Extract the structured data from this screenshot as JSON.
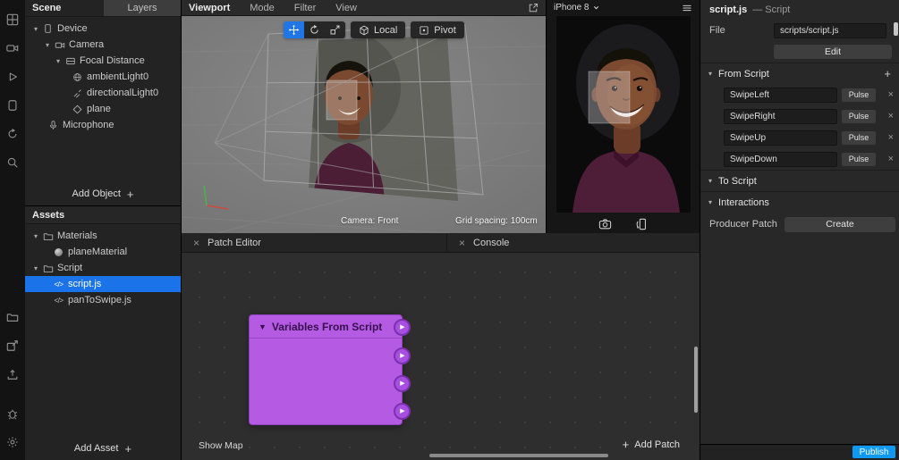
{
  "colors": {
    "accent_blue": "#1a73e8",
    "toolbar_active_blue": "#2176e5",
    "publish_blue": "#0f99f0",
    "node_purple": "#b55ae2",
    "viewport_gray": "#7c7c7c"
  },
  "rail": {
    "icons": [
      "apps-icon",
      "camera-icon",
      "play-icon",
      "device-icon",
      "sync-icon",
      "search-icon",
      "assets-icon",
      "export-icon",
      "upload-icon",
      "debug-icon",
      "settings-icon"
    ]
  },
  "scene_panel": {
    "tab_scene": "Scene",
    "tab_layers": "Layers",
    "items": [
      {
        "label": "Device"
      },
      {
        "label": "Camera"
      },
      {
        "label": "Focal Distance"
      },
      {
        "label": "ambientLight0"
      },
      {
        "label": "directionalLight0"
      },
      {
        "label": "plane"
      },
      {
        "label": "Microphone"
      }
    ],
    "add_object_label": "Add Object"
  },
  "assets_panel": {
    "title": "Assets",
    "items": [
      {
        "label": "Materials"
      },
      {
        "label": "planeMaterial"
      },
      {
        "label": "Script"
      },
      {
        "label": "script.js"
      },
      {
        "label": "panToSwipe.js"
      }
    ],
    "selected_item": "script.js",
    "add_asset_label": "Add Asset"
  },
  "viewport": {
    "menu": [
      {
        "label": "Viewport"
      },
      {
        "label": "Mode"
      },
      {
        "label": "Filter"
      },
      {
        "label": "View"
      }
    ],
    "local_label": "Local",
    "pivot_label": "Pivot",
    "camera_status": "Camera: Front",
    "grid_status": "Grid spacing: 100cm"
  },
  "simulator": {
    "device_label": "iPhone 8"
  },
  "inspector": {
    "title": "script.js",
    "title_suffix": "— Script",
    "file_label": "File",
    "file_value": "scripts/script.js",
    "edit_label": "Edit",
    "from_script_label": "From Script",
    "to_script_label": "To Script",
    "interactions_label": "Interactions",
    "variables": [
      {
        "name": "SwipeLeft",
        "type": "Pulse"
      },
      {
        "name": "SwipeRight",
        "type": "Pulse"
      },
      {
        "name": "SwipeUp",
        "type": "Pulse"
      },
      {
        "name": "SwipeDown",
        "type": "Pulse"
      }
    ],
    "producer_patch_label": "Producer Patch",
    "create_label": "Create",
    "publish_label": "Publish"
  },
  "patch_editor": {
    "tab_label": "Patch Editor",
    "console_tab_label": "Console",
    "node_title": "Variables From Script",
    "port_count": 4,
    "show_map_label": "Show Map",
    "add_patch_label": "Add Patch"
  }
}
